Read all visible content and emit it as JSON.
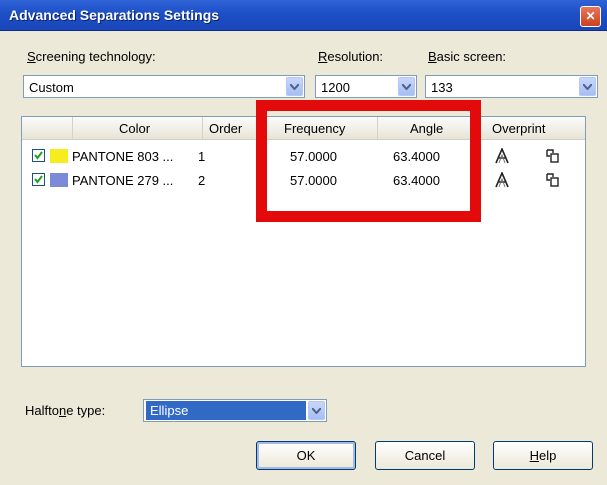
{
  "window": {
    "title": "Advanced Separations Settings"
  },
  "screening": {
    "label_first": "S",
    "label_rest": "creening technology:",
    "value": "Custom"
  },
  "resolution": {
    "label_first": "R",
    "label_rest": "esolution:",
    "value": "1200"
  },
  "basic_screen": {
    "label_first": "B",
    "label_rest": "asic screen:",
    "value": "133"
  },
  "table": {
    "columns": [
      "Color",
      "Order",
      "Frequency",
      "Angle",
      "Overprint"
    ],
    "rows": [
      {
        "checked": true,
        "swatch": "#f7ec1e",
        "color": "PANTONE 803 ...",
        "order": "1",
        "frequency": "57.0000",
        "angle": "63.4000"
      },
      {
        "checked": true,
        "swatch": "#7b8bd8",
        "color": "PANTONE 279 ...",
        "order": "2",
        "frequency": "57.0000",
        "angle": "63.4000"
      }
    ]
  },
  "halftone": {
    "label_pre": "Halfto",
    "label_ul": "n",
    "label_post": "e type:",
    "value": "Ellipse"
  },
  "buttons": {
    "ok": "OK",
    "cancel": "Cancel",
    "help_first": "H",
    "help_rest": "elp"
  },
  "colors": {
    "title_bar": "#1d4fc7",
    "highlight": "#e20a0a",
    "dialog_bg": "#ece9d8"
  }
}
